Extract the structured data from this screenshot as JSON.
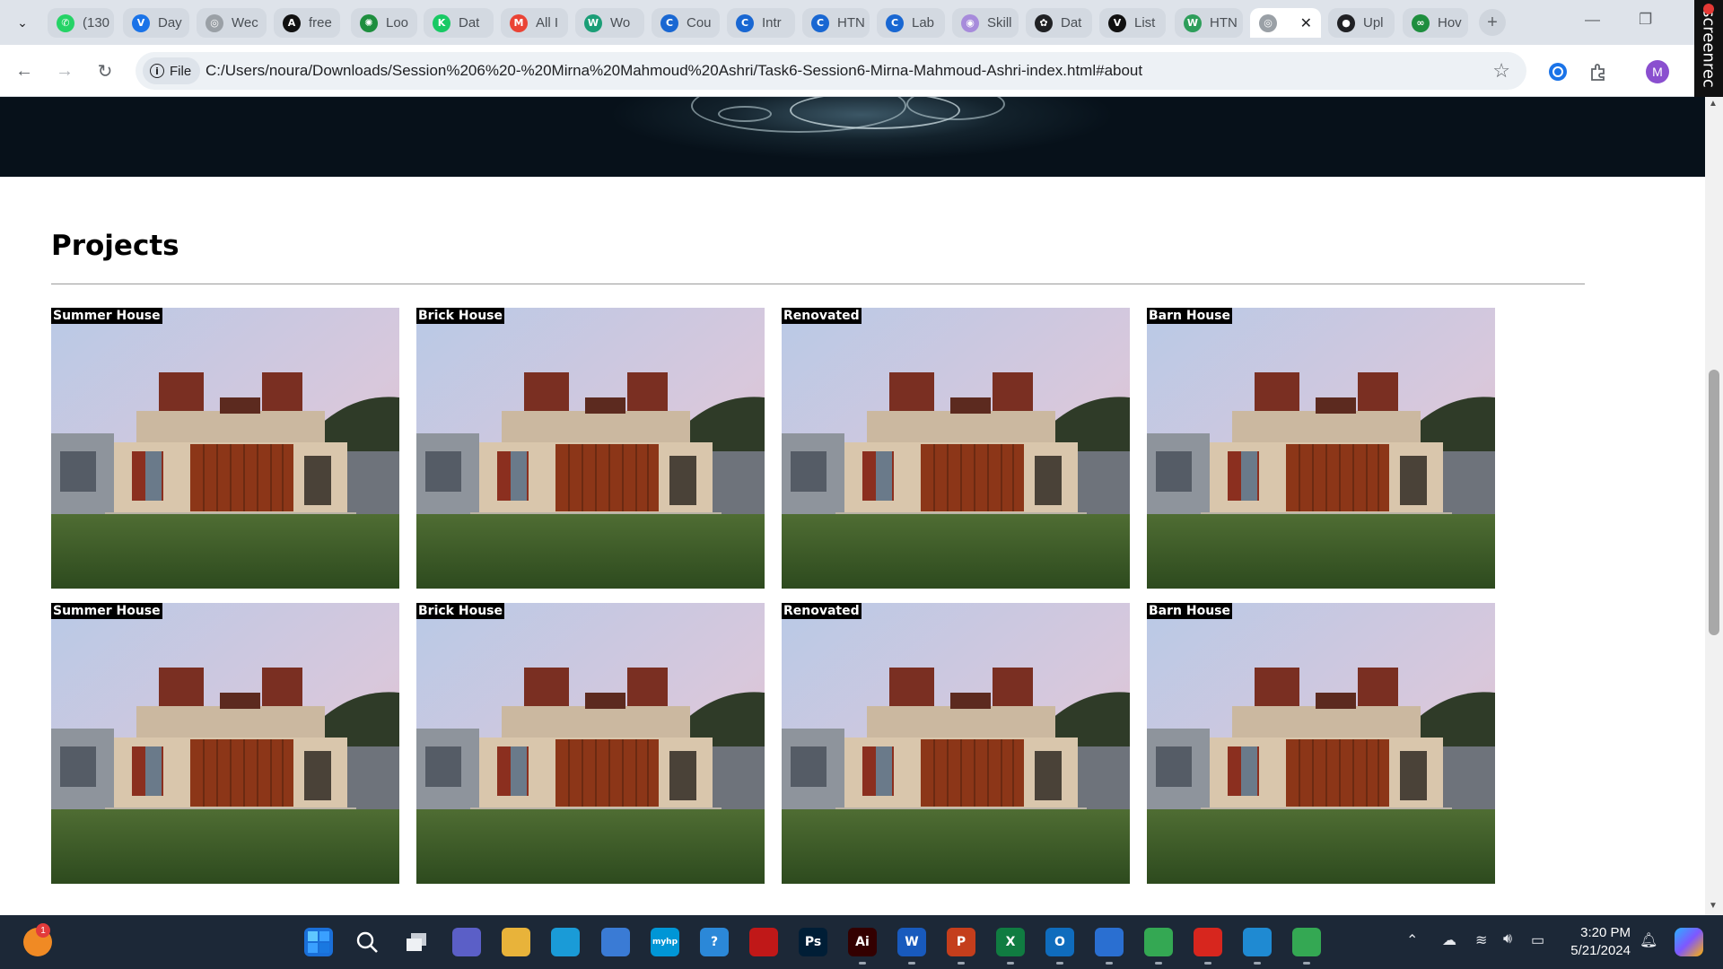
{
  "browser": {
    "tabs": [
      {
        "label": "(130",
        "icon": "whatsapp-icon",
        "color": "#25d366"
      },
      {
        "label": "Day",
        "icon": "v-icon",
        "color": "#1a73e8"
      },
      {
        "label": "Wec",
        "icon": "globe-icon",
        "color": "#9aa0a6"
      },
      {
        "label": "free",
        "icon": "a-icon",
        "color": "#111111"
      },
      {
        "label": "Loo",
        "icon": "loom-icon",
        "color": "#1e8e3e"
      },
      {
        "label": "Dat",
        "icon": "k-icon",
        "color": "#18c964"
      },
      {
        "label": "All I",
        "icon": "gmail-icon",
        "color": "#ea4335"
      },
      {
        "label": "Wo",
        "icon": "wordpress-icon",
        "color": "#1b9e77"
      },
      {
        "label": "Cou",
        "icon": "c-icon",
        "color": "#1967d2"
      },
      {
        "label": "Intr",
        "icon": "c-icon",
        "color": "#1967d2"
      },
      {
        "label": "HTN",
        "icon": "c-icon",
        "color": "#1967d2"
      },
      {
        "label": "Lab",
        "icon": "c-icon",
        "color": "#1967d2"
      },
      {
        "label": "Skill",
        "icon": "skill-icon",
        "color": "#a78bdb"
      },
      {
        "label": "Dat",
        "icon": "chatgpt-icon",
        "color": "#202124"
      },
      {
        "label": "List",
        "icon": "v-icon",
        "color": "#111111"
      },
      {
        "label": "HTN",
        "icon": "w-icon",
        "color": "#2e9e5b"
      },
      {
        "label": "",
        "icon": "globe-icon",
        "color": "#9aa0a6",
        "active": true
      },
      {
        "label": "Upl",
        "icon": "github-icon",
        "color": "#202124"
      },
      {
        "label": "Hov",
        "icon": "link-icon",
        "color": "#1e8e3e"
      }
    ],
    "chip_label": "File",
    "url": "C:/Users/noura/Downloads/Session%206%20-%20Mirna%20Mahmoud%20Ashri/Task6-Session6-Mirna-Mahmoud-Ashri-index.html#about",
    "profile_initial": "M",
    "recorder_label": "screenrec"
  },
  "page": {
    "section_title": "Projects",
    "projects": [
      {
        "label": "Summer House"
      },
      {
        "label": "Brick House"
      },
      {
        "label": "Renovated"
      },
      {
        "label": "Barn House"
      },
      {
        "label": "Summer House"
      },
      {
        "label": "Brick House"
      },
      {
        "label": "Renovated"
      },
      {
        "label": "Barn House"
      }
    ]
  },
  "taskbar": {
    "notification_count": "1",
    "apps": [
      {
        "name": "start-icon",
        "glyph": "",
        "color": "#1a6fd8"
      },
      {
        "name": "search-icon",
        "glyph": "",
        "color": "transparent"
      },
      {
        "name": "task-view-icon",
        "glyph": "",
        "color": "transparent"
      },
      {
        "name": "meet-icon",
        "glyph": "",
        "color": "#5b5fc7"
      },
      {
        "name": "file-explorer-icon",
        "glyph": "",
        "color": "#e8b33a"
      },
      {
        "name": "edge-icon",
        "glyph": "",
        "color": "#1a9bd7"
      },
      {
        "name": "store-icon",
        "glyph": "",
        "color": "#3a7bd5"
      },
      {
        "name": "myhp-icon",
        "glyph": "myhp",
        "color": "#0096d6"
      },
      {
        "name": "help-icon",
        "glyph": "?",
        "color": "#2b88d8"
      },
      {
        "name": "mcafee-icon",
        "glyph": "",
        "color": "#c01818"
      },
      {
        "name": "photoshop-icon",
        "glyph": "Ps",
        "color": "#001e36"
      },
      {
        "name": "illustrator-icon",
        "glyph": "Ai",
        "color": "#330000"
      },
      {
        "name": "word-icon",
        "glyph": "W",
        "color": "#185abd"
      },
      {
        "name": "powerpoint-icon",
        "glyph": "P",
        "color": "#c43e1c"
      },
      {
        "name": "excel-icon",
        "glyph": "X",
        "color": "#107c41"
      },
      {
        "name": "outlook-icon",
        "glyph": "O",
        "color": "#0f6cbd"
      },
      {
        "name": "eye-app-icon",
        "glyph": "",
        "color": "#2a6fd1"
      },
      {
        "name": "chrome-icon",
        "glyph": "",
        "color": "#34a853"
      },
      {
        "name": "acrobat-icon",
        "glyph": "",
        "color": "#d7261e"
      },
      {
        "name": "vscode-icon",
        "glyph": "",
        "color": "#1f8ad2"
      },
      {
        "name": "chrome-profile-icon",
        "glyph": "",
        "color": "#34a853"
      }
    ],
    "time": "3:20 PM",
    "date": "5/21/2024"
  }
}
